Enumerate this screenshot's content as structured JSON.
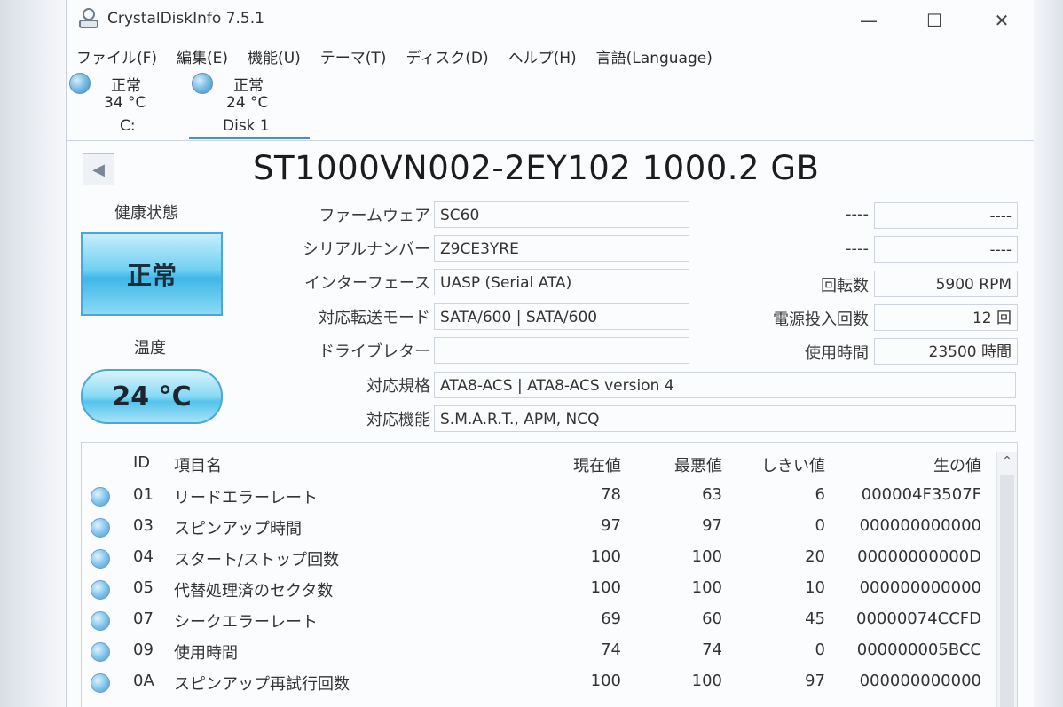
{
  "window": {
    "title": "CrystalDiskInfo 7.5.1",
    "minimize": "—",
    "maximize": "☐",
    "close": "✕"
  },
  "menu": [
    "ファイル(F)",
    "編集(E)",
    "機能(U)",
    "テーマ(T)",
    "ディスク(D)",
    "ヘルプ(H)",
    "言語(Language)"
  ],
  "disk_tabs": [
    {
      "status": "正常",
      "temp": "34 °C",
      "name": "C:"
    },
    {
      "status": "正常",
      "temp": "24 °C",
      "name": "Disk 1"
    }
  ],
  "model": "ST1000VN002-2EY102 1000.2 GB",
  "health": {
    "label": "健康状態",
    "value": "正常",
    "color": "#4fc0ec"
  },
  "temperature": {
    "label": "温度",
    "value": "24 °C"
  },
  "info": {
    "firmware": {
      "label": "ファームウェア",
      "value": "SC60"
    },
    "serial": {
      "label": "シリアルナンバー",
      "value": "Z9CE3YRE"
    },
    "interface": {
      "label": "インターフェース",
      "value": "UASP (Serial ATA)"
    },
    "transfer": {
      "label": "対応転送モード",
      "value": "SATA/600 | SATA/600"
    },
    "drive_letter": {
      "label": "ドライブレター",
      "value": ""
    },
    "standard": {
      "label": "対応規格",
      "value": "ATA8-ACS | ATA8-ACS version 4"
    },
    "features": {
      "label": "対応機能",
      "value": "S.M.A.R.T., APM, NCQ"
    }
  },
  "right_info": {
    "blank1": {
      "label": "----",
      "value": "----"
    },
    "blank2": {
      "label": "----",
      "value": "----"
    },
    "rotation": {
      "label": "回転数",
      "value": "5900 RPM"
    },
    "power_count": {
      "label": "電源投入回数",
      "value": "12 回"
    },
    "power_hours": {
      "label": "使用時間",
      "value": "23500 時間"
    }
  },
  "smart_headers": {
    "id": "ID",
    "name": "項目名",
    "current": "現在値",
    "worst": "最悪値",
    "threshold": "しきい値",
    "raw": "生の値"
  },
  "smart_rows": [
    {
      "id": "01",
      "name": "リードエラーレート",
      "current": "78",
      "worst": "63",
      "threshold": "6",
      "raw": "000004F3507F"
    },
    {
      "id": "03",
      "name": "スピンアップ時間",
      "current": "97",
      "worst": "97",
      "threshold": "0",
      "raw": "000000000000"
    },
    {
      "id": "04",
      "name": "スタート/ストップ回数",
      "current": "100",
      "worst": "100",
      "threshold": "20",
      "raw": "00000000000D"
    },
    {
      "id": "05",
      "name": "代替処理済のセクタ数",
      "current": "100",
      "worst": "100",
      "threshold": "10",
      "raw": "000000000000"
    },
    {
      "id": "07",
      "name": "シークエラーレート",
      "current": "69",
      "worst": "60",
      "threshold": "45",
      "raw": "00000074CCFD"
    },
    {
      "id": "09",
      "name": "使用時間",
      "current": "74",
      "worst": "74",
      "threshold": "0",
      "raw": "000000005BCC"
    },
    {
      "id": "0A",
      "name": "スピンアップ再試行回数",
      "current": "100",
      "worst": "100",
      "threshold": "97",
      "raw": "000000000000"
    }
  ]
}
